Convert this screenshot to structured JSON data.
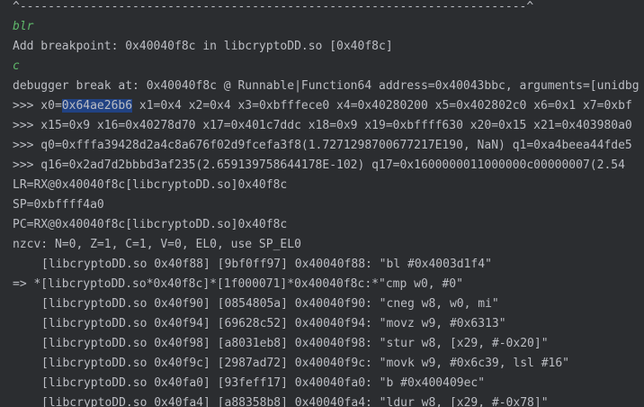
{
  "separator": "^------------------------------------------------------------------------^",
  "lines": {
    "cmd_blr": "blr",
    "breakpoint_added": "Add breakpoint: 0x40040f8c in libcryptoDD.so [0x40f8c]",
    "cmd_c": "c",
    "break_info": "debugger break at: 0x40040f8c @ Runnable|Function64 address=0x40043bbc, arguments=[unidbg",
    "regs1_prefix": ">>> x0=",
    "regs1_selected": "0x64ae26b6",
    "regs1_rest": " x1=0x4 x2=0x4 x3=0xbfffece0 x4=0x40280200 x5=0x402802c0 x6=0x1 x7=0xbf",
    "regs2": ">>> x15=0x9 x16=0x40278d70 x17=0x401c7ddc x18=0x9 x19=0xbffff630 x20=0x15 x21=0x403980a0",
    "regs3": ">>> q0=0xfffa39428d2a4c8a676f02d9fcefa3f8(1.7271298700677217E190, NaN) q1=0xa4beea44fde5",
    "regs4": ">>> q16=0x2ad7d2bbbd3af235(2.659139758644178E-102) q17=0x1600000011000000c00000007(2.54",
    "lr": "LR=RX@0x40040f8c[libcryptoDD.so]0x40f8c",
    "sp": "SP=0xbffff4a0",
    "pc": "PC=RX@0x40040f8c[libcryptoDD.so]0x40f8c",
    "nzcv": "nzcv: N=0, Z=1, C=1, V=0, EL0, use SP_EL0"
  },
  "disasm": [
    {
      "text": "[libcryptoDD.so 0x40f88] [9bf0ff97] 0x40040f88: \"bl #0x4003d1f4\""
    },
    {
      "text": "=> *[libcryptoDD.so*0x40f8c]*[1f000071]*0x40040f8c:*\"cmp w0, #0\"",
      "current": true
    },
    {
      "text": "[libcryptoDD.so 0x40f90] [0854805a] 0x40040f90: \"cneg w8, w0, mi\""
    },
    {
      "text": "[libcryptoDD.so 0x40f94] [69628c52] 0x40040f94: \"movz w9, #0x6313\""
    },
    {
      "text": "[libcryptoDD.so 0x40f98] [a8031eb8] 0x40040f98: \"stur w8, [x29, #-0x20]\""
    },
    {
      "text": "[libcryptoDD.so 0x40f9c] [2987ad72] 0x40040f9c: \"movk w9, #0x6c39, lsl #16\""
    },
    {
      "text": "[libcryptoDD.so 0x40fa0] [93feff17] 0x40040fa0: \"b #0x400409ec\""
    },
    {
      "text": "[libcryptoDD.so 0x40fa4] [a88358b8] 0x40040fa4: \"ldur w8, [x29, #-0x78]\""
    }
  ],
  "colors": {
    "background": "#2b2d30",
    "text": "#bcbec4",
    "command": "#5fb86a",
    "selection": "#214283"
  }
}
